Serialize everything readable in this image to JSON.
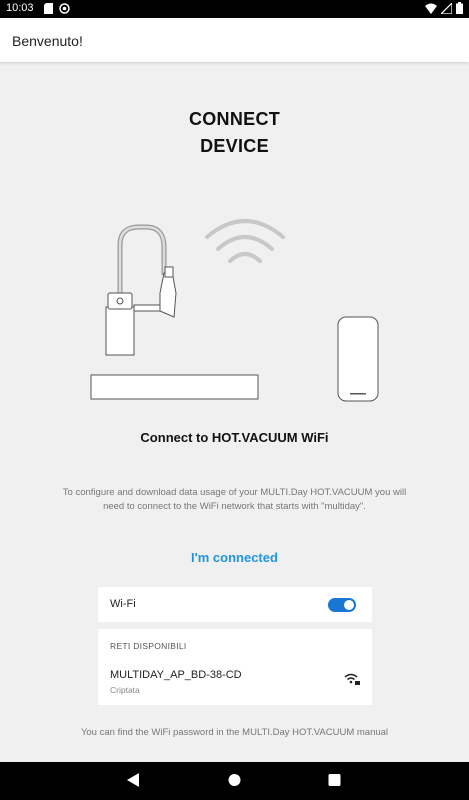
{
  "status_bar": {
    "time": "10:03"
  },
  "app_bar": {
    "title": "Benvenuto!"
  },
  "heading": {
    "line1": "CONNECT",
    "line2": "DEVICE"
  },
  "subtitle": "Connect to HOT.VACUUM WiFi",
  "description": {
    "line1": "To configure and download data usage of your MULTI.Day HOT.VACUUM you will",
    "line2": "need to connect to the WiFi network that starts with \"multiday\"."
  },
  "connected_link": "I'm connected",
  "wifi_settings": {
    "label": "Wi-Fi",
    "enabled": true,
    "section_header": "RETI DISPONIBILI",
    "network": {
      "ssid": "MULTIDAY_AP_BD-38-CD",
      "security": "Criptata"
    }
  },
  "footer": "You can find the WiFi password in the MULTI.Day HOT.VACUUM manual",
  "colors": {
    "accent": "#2196e0",
    "toggle": "#1976d2",
    "background": "#f0f0f0"
  }
}
